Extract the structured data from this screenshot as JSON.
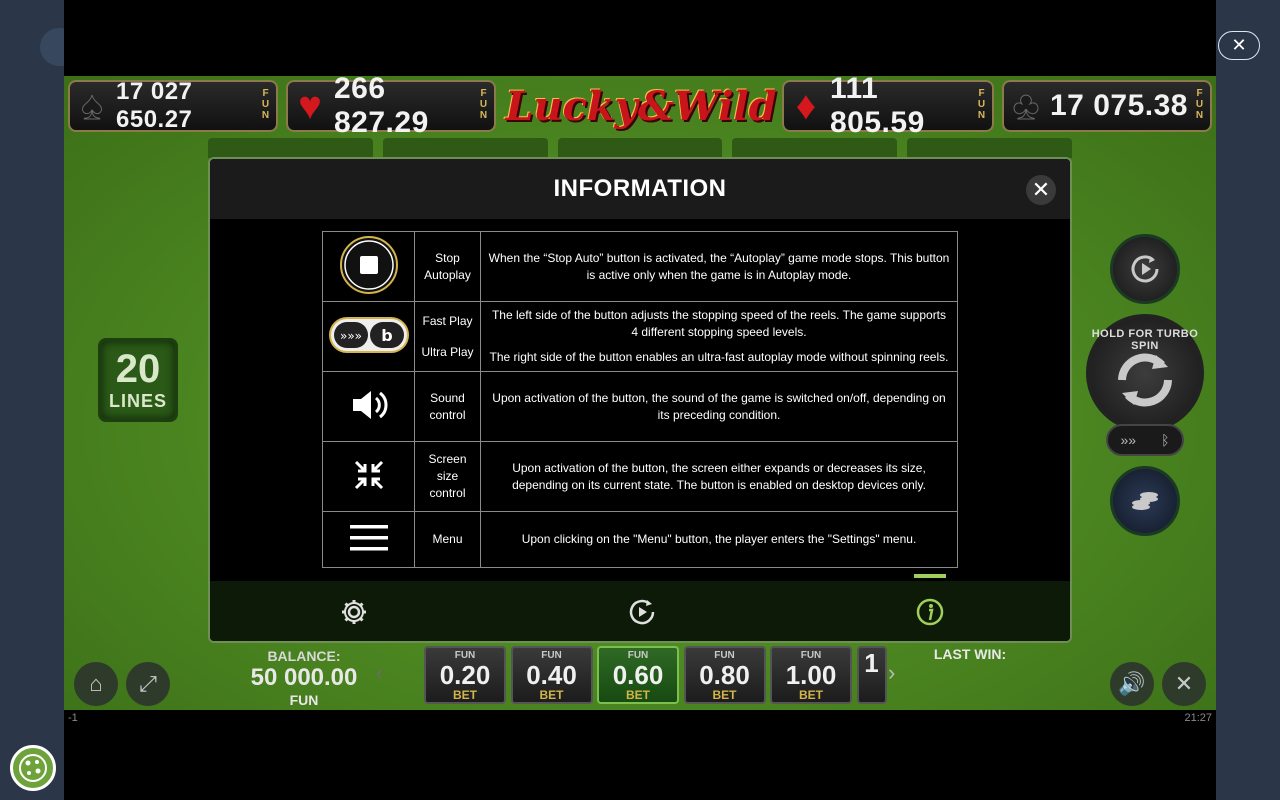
{
  "jackpots": [
    {
      "suit": "spade",
      "value": "17 027 650.27",
      "fun": "FUN"
    },
    {
      "suit": "heart",
      "value": "266 827.29",
      "fun": "FUN"
    },
    {
      "suit": "diamond",
      "value": "111 805.59",
      "fun": "FUN"
    },
    {
      "suit": "club",
      "value": "17 075.38",
      "fun": "FUN"
    }
  ],
  "logo": {
    "text": "Lucky&Wild"
  },
  "lines": {
    "number": "20",
    "label": "LINES"
  },
  "spin": {
    "hold_text": "HOLD FOR TURBO SPIN"
  },
  "modal": {
    "title": "INFORMATION",
    "rows": [
      {
        "icon": "stop-icon",
        "name": [
          "Stop",
          "Autoplay"
        ],
        "desc": [
          "When the “Stop Auto” button is activated, the “Autoplay” game mode stops. This button is active only when the game is in Autoplay mode."
        ]
      },
      {
        "icon": "fast-play-icon",
        "name": [
          "Fast Play",
          "Ultra Play"
        ],
        "desc": [
          "The left side of the button adjusts the stopping speed of the reels. The game supports 4 different stopping speed levels.",
          "The right side of the button enables an ultra-fast autoplay mode without spinning reels."
        ]
      },
      {
        "icon": "speaker-icon",
        "name": [
          "Sound",
          "control"
        ],
        "desc": [
          "Upon activation of the button, the sound of the game is switched on/off, depending on its preceding condition."
        ]
      },
      {
        "icon": "collapse-icon",
        "name": [
          "Screen",
          "size",
          "control"
        ],
        "desc": [
          "Upon activation of the button, the screen either expands or decreases its size, depending on its current state. The button is enabled on desktop devices only."
        ]
      },
      {
        "icon": "menu-icon",
        "name": [
          "Menu"
        ],
        "desc": [
          "Upon clicking on the \"Menu\" button, the player enters the \"Settings\" menu."
        ]
      }
    ],
    "footer_tabs": [
      {
        "icon": "gear-icon",
        "active": false
      },
      {
        "icon": "autoplay-icon",
        "active": false
      },
      {
        "icon": "info-icon",
        "active": true
      }
    ]
  },
  "balance": {
    "label": "BALANCE:",
    "value": "50 000.00",
    "currency": "FUN"
  },
  "bets": [
    {
      "fun": "FUN",
      "value": "0.20",
      "label": "BET",
      "active": false
    },
    {
      "fun": "FUN",
      "value": "0.40",
      "label": "BET",
      "active": false
    },
    {
      "fun": "FUN",
      "value": "0.60",
      "label": "BET",
      "active": true
    },
    {
      "fun": "FUN",
      "value": "0.80",
      "label": "BET",
      "active": false
    },
    {
      "fun": "FUN",
      "value": "1.00",
      "label": "BET",
      "active": false
    },
    {
      "fun": "",
      "value": "1",
      "label": "",
      "active": false
    }
  ],
  "last_win": {
    "label": "LAST WIN:"
  },
  "footer": {
    "left": "-1",
    "time": "21:27"
  },
  "colors": {
    "accent": "#9fd05a",
    "gold": "#d3b44a",
    "heart": "#d4181e",
    "modal_border": "#6f8f56"
  }
}
